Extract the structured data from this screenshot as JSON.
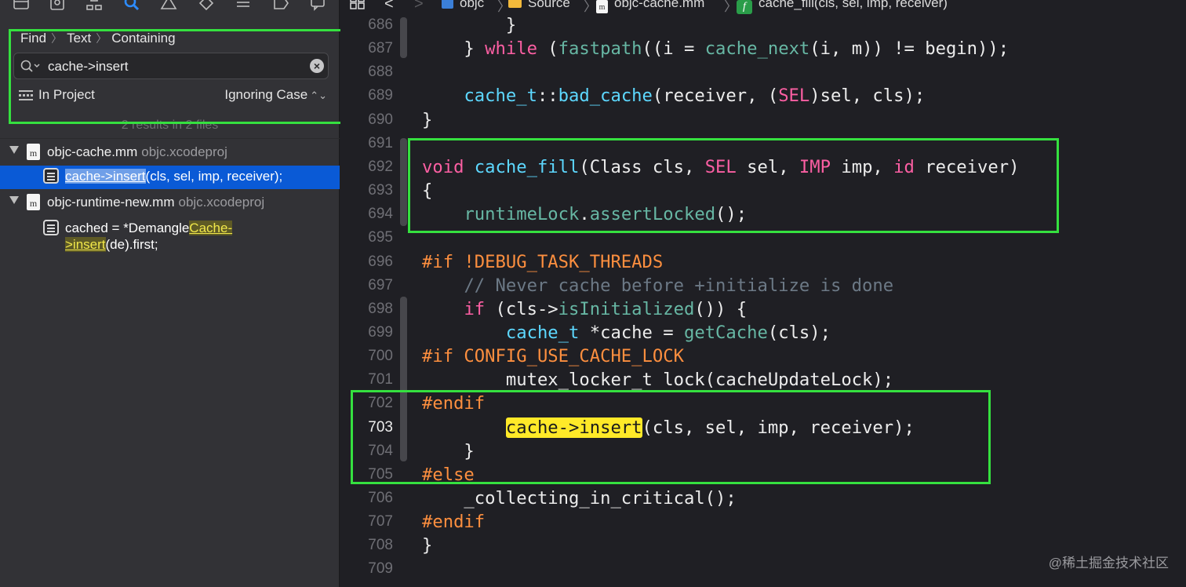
{
  "navigator": {
    "toolbar_icons": [
      "folder-icon",
      "source-control-icon",
      "hierarchy-icon",
      "find-icon",
      "issue-icon",
      "test-icon",
      "debug-icon",
      "breakpoint-icon",
      "report-icon"
    ],
    "find_path": [
      "Find",
      "Text",
      "Containing"
    ],
    "search": {
      "value": "cache->insert"
    },
    "scope_label": "In Project",
    "case_option": "Ignoring Case",
    "results_summary": "2 results in 2 files",
    "files": [
      {
        "name": "objc-cache.mm",
        "project": "objc.xcodeproj",
        "matches": [
          {
            "before": "",
            "match": "cache->insert",
            "after": "(cls, sel, imp, receiver);",
            "selected": true
          }
        ]
      },
      {
        "name": "objc-runtime-new.mm",
        "project": "objc.xcodeproj",
        "matches": [
          {
            "before": "cached = *Demangle",
            "match": "Cache->insert",
            "after": "(de).first;",
            "selected": false
          }
        ]
      }
    ]
  },
  "jumpbar": {
    "project": "objc",
    "folder": "Source",
    "file": "objc-cache.mm",
    "symbol": "cache_fill(cls, sel, imp, receiver)"
  },
  "editor": {
    "current_line": 703,
    "lines": [
      {
        "n": "686",
        "tokens": [
          {
            "t": "        }"
          }
        ]
      },
      {
        "n": "687",
        "tokens": [
          {
            "t": "    } "
          },
          {
            "t": "while",
            "c": "kw"
          },
          {
            "t": " ("
          },
          {
            "t": "fastpath",
            "c": "fn"
          },
          {
            "t": "((i = "
          },
          {
            "t": "cache_next",
            "c": "fn"
          },
          {
            "t": "(i, m)) != begin));"
          }
        ]
      },
      {
        "n": "688",
        "tokens": []
      },
      {
        "n": "689",
        "tokens": [
          {
            "t": "    "
          },
          {
            "t": "cache_t",
            "c": "ty"
          },
          {
            "t": "::"
          },
          {
            "t": "bad_cache",
            "c": "ty"
          },
          {
            "t": "(receiver, ("
          },
          {
            "t": "SEL",
            "c": "kw"
          },
          {
            "t": ")sel, cls);"
          }
        ]
      },
      {
        "n": "690",
        "tokens": [
          {
            "t": "}"
          }
        ]
      },
      {
        "n": "691",
        "tokens": []
      },
      {
        "n": "692",
        "tokens": [
          {
            "t": "void",
            "c": "kw"
          },
          {
            "t": " "
          },
          {
            "t": "cache_fill",
            "c": "ty"
          },
          {
            "t": "(Class cls, "
          },
          {
            "t": "SEL",
            "c": "kw"
          },
          {
            "t": " sel, "
          },
          {
            "t": "IMP",
            "c": "kw"
          },
          {
            "t": " imp, "
          },
          {
            "t": "id",
            "c": "kw"
          },
          {
            "t": " receiver)"
          }
        ]
      },
      {
        "n": "693",
        "tokens": [
          {
            "t": "{"
          }
        ]
      },
      {
        "n": "694",
        "tokens": [
          {
            "t": "    "
          },
          {
            "t": "runtimeLock",
            "c": "fn"
          },
          {
            "t": "."
          },
          {
            "t": "assertLocked",
            "c": "fn"
          },
          {
            "t": "();"
          }
        ]
      },
      {
        "n": "695",
        "tokens": []
      },
      {
        "n": "696",
        "tokens": [
          {
            "t": "#if !DEBUG_TASK_THREADS",
            "c": "pp"
          }
        ]
      },
      {
        "n": "697",
        "tokens": [
          {
            "t": "    "
          },
          {
            "t": "// Never cache before +initialize is done",
            "c": "cm"
          }
        ]
      },
      {
        "n": "698",
        "tokens": [
          {
            "t": "    "
          },
          {
            "t": "if",
            "c": "kw"
          },
          {
            "t": " (cls->"
          },
          {
            "t": "isInitialized",
            "c": "fn"
          },
          {
            "t": "()) {"
          }
        ]
      },
      {
        "n": "699",
        "tokens": [
          {
            "t": "        "
          },
          {
            "t": "cache_t",
            "c": "ty"
          },
          {
            "t": " *cache = "
          },
          {
            "t": "getCache",
            "c": "fn"
          },
          {
            "t": "(cls);"
          }
        ]
      },
      {
        "n": "700",
        "tokens": [
          {
            "t": "#if CONFIG_USE_CACHE_LOCK",
            "c": "pp"
          }
        ]
      },
      {
        "n": "701",
        "tokens": [
          {
            "t": "        mutex_locker_t lock(cacheUpdateLock);"
          }
        ]
      },
      {
        "n": "702",
        "tokens": [
          {
            "t": "#endif",
            "c": "pp"
          }
        ]
      },
      {
        "n": "703",
        "tokens": [
          {
            "t": "        "
          },
          {
            "t": "cache->insert",
            "c": "mk"
          },
          {
            "t": "(cls, sel, imp, receiver);"
          }
        ]
      },
      {
        "n": "704",
        "tokens": [
          {
            "t": "    }"
          }
        ]
      },
      {
        "n": "705",
        "tokens": [
          {
            "t": "#else",
            "c": "pp"
          }
        ]
      },
      {
        "n": "706",
        "tokens": [
          {
            "t": "    _collecting_in_critical();"
          }
        ]
      },
      {
        "n": "707",
        "tokens": [
          {
            "t": "#endif",
            "c": "pp"
          }
        ]
      },
      {
        "n": "708",
        "tokens": [
          {
            "t": "}"
          }
        ]
      },
      {
        "n": "709",
        "tokens": []
      }
    ]
  },
  "annotation_color": "#35e03f",
  "watermark": "@稀土掘金技术社区"
}
